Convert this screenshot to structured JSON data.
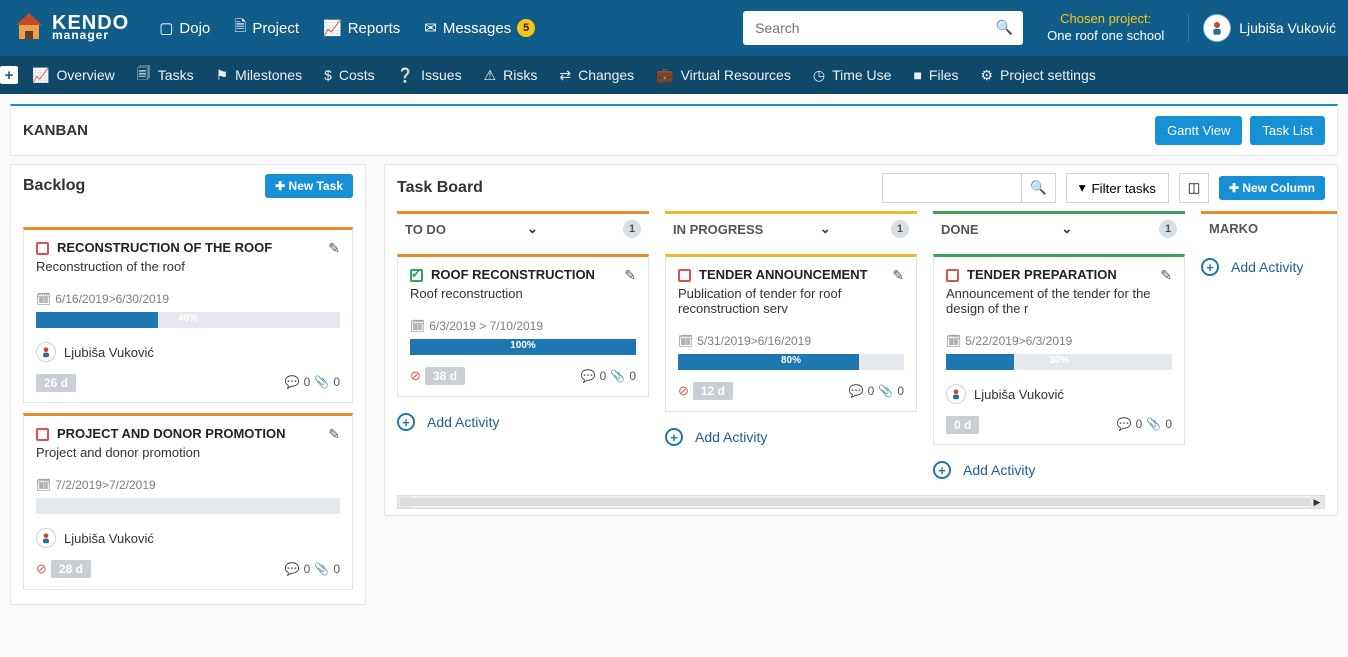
{
  "header": {
    "logo_line1": "KENDO",
    "logo_line2": "manager",
    "nav": {
      "dojo": "Dojo",
      "project": "Project",
      "reports": "Reports",
      "messages": "Messages",
      "messages_badge": "5"
    },
    "search_placeholder": "Search",
    "chosen_project_label": "Chosen project:",
    "chosen_project_name": "One roof one school",
    "user_name": "Ljubiša Vuković"
  },
  "subnav": {
    "overview": "Overview",
    "tasks": "Tasks",
    "milestones": "Milestones",
    "costs": "Costs",
    "issues": "Issues",
    "risks": "Risks",
    "changes": "Changes",
    "virtual_resources": "Virtual Resources",
    "time_use": "Time Use",
    "files": "Files",
    "project_settings": "Project settings"
  },
  "page": {
    "title": "KANBAN",
    "gantt_view": "Gantt View",
    "task_list": "Task List"
  },
  "backlog": {
    "title": "Backlog",
    "new_task": "New Task",
    "cards": [
      {
        "title": "RECONSTRUCTION OF THE ROOF",
        "desc": "Reconstruction of the roof",
        "dates": "6/16/2019>6/30/2019",
        "progress_label": "40%",
        "progress_pct": 40,
        "assignee": "Ljubiša Vuković",
        "days": "26 d",
        "comments": "0",
        "attachments": "0",
        "alert": false
      },
      {
        "title": "PROJECT AND DONOR PROMOTION",
        "desc": "Project and donor promotion",
        "dates": "7/2/2019>7/2/2019",
        "progress_label": "",
        "progress_pct": 0,
        "assignee": "Ljubiša Vuković",
        "days": "28 d",
        "comments": "0",
        "attachments": "0",
        "alert": true
      }
    ]
  },
  "taskboard": {
    "title": "Task Board",
    "filter_tasks": "Filter tasks",
    "new_column": "New Column",
    "add_activity": "Add Activity",
    "columns": [
      {
        "name": "TO DO",
        "color": "#e88b2e",
        "count": "1",
        "cards": [
          {
            "done": true,
            "title": "ROOF RECONSTRUCTION",
            "desc": "Roof reconstruction",
            "dates": "6/3/2019 > 7/10/2019",
            "progress_label": "100%",
            "progress_pct": 100,
            "assignee": "",
            "days": "38 d",
            "comments": "0",
            "attachments": "0",
            "alert": true
          }
        ]
      },
      {
        "name": "IN PROGRESS",
        "color": "#f2b92e",
        "count": "1",
        "cards": [
          {
            "done": false,
            "title": "TENDER ANNOUNCEMENT",
            "desc": "Publication of tender for roof reconstruction serv",
            "dates": "5/31/2019>6/16/2019",
            "progress_label": "80%",
            "progress_pct": 80,
            "assignee": "",
            "days": "12 d",
            "comments": "0",
            "attachments": "0",
            "alert": true
          }
        ]
      },
      {
        "name": "DONE",
        "color": "#3aa655",
        "count": "1",
        "cards": [
          {
            "done": false,
            "title": "TENDER PREPARATION",
            "desc": "Announcement of the tender for the design of the r",
            "dates": "5/22/2019>6/3/2019",
            "progress_label": "30%",
            "progress_pct": 30,
            "assignee": "Ljubiša Vuković",
            "days": "0 d",
            "comments": "0",
            "attachments": "0",
            "alert": false
          }
        ]
      },
      {
        "name": "MARKO",
        "color": "#e88b2e",
        "count": "",
        "cards": []
      }
    ]
  }
}
